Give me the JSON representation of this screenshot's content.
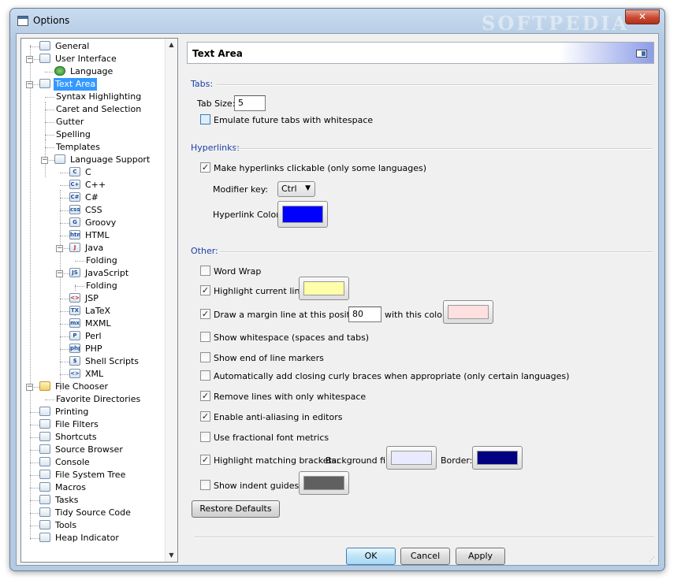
{
  "window": {
    "title": "Options",
    "close_label": "✕",
    "watermark": "SOFTPEDIA"
  },
  "tree": {
    "scroll_up": "▲",
    "scroll_down": "▼",
    "items": [
      {
        "label": "General",
        "icon": "document-icon"
      },
      {
        "label": "User Interface",
        "icon": "window-icon"
      },
      {
        "label": "Language",
        "icon": "globe-icon"
      },
      {
        "label": "Text Area",
        "icon": "text-area-icon",
        "selected": true
      },
      {
        "label": "Syntax Highlighting"
      },
      {
        "label": "Caret and Selection"
      },
      {
        "label": "Gutter"
      },
      {
        "label": "Spelling"
      },
      {
        "label": "Templates"
      },
      {
        "label": "Language Support",
        "icon": "speech-bubble-icon"
      },
      {
        "label": "C",
        "icon": "c-language-icon"
      },
      {
        "label": "C++",
        "icon": "cpp-language-icon"
      },
      {
        "label": "C#",
        "icon": "csharp-language-icon"
      },
      {
        "label": "CSS",
        "icon": "css-icon"
      },
      {
        "label": "Groovy",
        "icon": "groovy-icon"
      },
      {
        "label": "HTML",
        "icon": "html-icon"
      },
      {
        "label": "Java",
        "icon": "java-cup-icon"
      },
      {
        "label": "Folding"
      },
      {
        "label": "JavaScript",
        "icon": "javascript-icon"
      },
      {
        "label": "Folding"
      },
      {
        "label": "JSP",
        "icon": "jsp-icon"
      },
      {
        "label": "LaTeX",
        "icon": "latex-icon"
      },
      {
        "label": "MXML",
        "icon": "mxml-icon"
      },
      {
        "label": "Perl",
        "icon": "perl-camel-icon"
      },
      {
        "label": "PHP",
        "icon": "php-icon"
      },
      {
        "label": "Shell Scripts",
        "icon": "penguin-icon"
      },
      {
        "label": "XML",
        "icon": "xml-icon"
      },
      {
        "label": "File Chooser",
        "icon": "folder-icon"
      },
      {
        "label": "Favorite Directories"
      },
      {
        "label": "Printing",
        "icon": "printer-icon"
      },
      {
        "label": "File Filters",
        "icon": "filter-icon"
      },
      {
        "label": "Shortcuts",
        "icon": "keyboard-icon"
      },
      {
        "label": "Source Browser",
        "icon": "list-icon"
      },
      {
        "label": "Console",
        "icon": "monitor-icon"
      },
      {
        "label": "File System Tree",
        "icon": "tree-icon"
      },
      {
        "label": "Macros",
        "icon": "gear-icon"
      },
      {
        "label": "Tasks",
        "icon": "pencil-icon"
      },
      {
        "label": "Tidy Source Code",
        "icon": "lightning-icon"
      },
      {
        "label": "Tools",
        "icon": "wrench-icon"
      },
      {
        "label": "Heap Indicator",
        "icon": "bar-icon"
      }
    ]
  },
  "panel": {
    "title": "Text Area",
    "tabs_section": "Tabs:",
    "tab_size_label": "Tab Size:",
    "tab_size_value": "5",
    "emulate_tabs_label": "Emulate future tabs with whitespace",
    "hyperlinks_section": "Hyperlinks:",
    "hyperlinks_clickable_label": "Make hyperlinks clickable (only some languages)",
    "modifier_key_label": "Modifier key:",
    "modifier_key_value": "Ctrl",
    "hyperlink_color_label": "Hyperlink Color:",
    "other_section": "Other:",
    "word_wrap_label": "Word Wrap",
    "highlight_line_label": "Highlight current line:",
    "margin_line_label": "Draw a margin line at this position:",
    "margin_line_value": "80",
    "margin_color_label": "with this color:",
    "show_whitespace_label": "Show whitespace (spaces and tabs)",
    "show_eol_label": "Show end of line markers",
    "auto_braces_label": "Automatically add closing curly braces when appropriate (only certain languages)",
    "remove_ws_lines_label": "Remove lines with only whitespace",
    "antialias_label": "Enable anti-aliasing in editors",
    "fractional_metrics_label": "Use fractional font metrics",
    "match_brackets_label": "Highlight matching brackets:",
    "bg_fill_label": "Background fill:",
    "border_label": "Border:",
    "indent_guides_label": "Show indent guides:",
    "restore_defaults_label": "Restore Defaults",
    "check_mark": "✓"
  },
  "colors": {
    "hyperlink": "#0000ff",
    "current_line": "#ffffaa",
    "margin_line": "#ffe0e0",
    "bracket_fill": "#eaeaff",
    "bracket_border": "#000080",
    "indent_guide": "#606060",
    "selection": "#3399ff"
  },
  "dialog_buttons": {
    "ok": "OK",
    "cancel": "Cancel",
    "apply": "Apply"
  }
}
